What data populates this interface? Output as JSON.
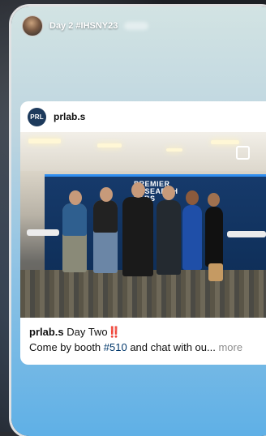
{
  "story": {
    "title": "Day 2 #IHSNY23"
  },
  "post": {
    "avatar_text": "PRL",
    "username": "prlab.s",
    "booth_sign": "PREMIER RESEARCH LABS"
  },
  "caption": {
    "username": "prlab.s",
    "headline": "Day Two",
    "emphasis": "‼️",
    "line2_prefix": "Come by booth ",
    "hashtag": "#510",
    "line2_suffix": " and chat with ou...",
    "more": "more"
  },
  "colors": {
    "hashtag": "#00376b",
    "booth": "#163a6b",
    "accent_bar": "#2f8ef0"
  }
}
